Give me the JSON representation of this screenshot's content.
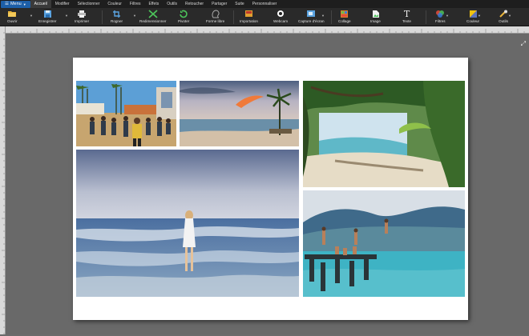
{
  "menu": {
    "button": "Menu"
  },
  "tabs": [
    "Accueil",
    "Modifier",
    "Sélectionner",
    "Couleur",
    "Filtres",
    "Effets",
    "Outils",
    "Retoucher",
    "Partager",
    "Suite",
    "Personnaliser"
  ],
  "tools": {
    "open": "Ouvrir",
    "save": "Enregistrer",
    "print": "Imprimer",
    "crop": "Rogner",
    "resize": "Redimensionner",
    "rotate": "Pivoter",
    "freeform": "Forme libre",
    "import": "Importation",
    "webcam": "Webcam",
    "capture": "Capture d'écran",
    "collage": "Collage",
    "image": "Image",
    "text": "Texte",
    "filters": "Filtres",
    "color": "Couleur",
    "tools": "Outils"
  },
  "colors": {
    "accent": "#1d5fa8",
    "toolbar": "#2a2a2a",
    "canvas": "#696969"
  },
  "icons": [
    "folder-icon",
    "floppy-icon",
    "printer-icon",
    "crop-icon",
    "resize-icon",
    "rotate-icon",
    "freeform-icon",
    "import-icon",
    "webcam-icon",
    "capture-icon",
    "collage-icon",
    "image-icon",
    "text-icon",
    "filters-icon",
    "color-icon",
    "tools-icon",
    "fit-screen-icon"
  ]
}
